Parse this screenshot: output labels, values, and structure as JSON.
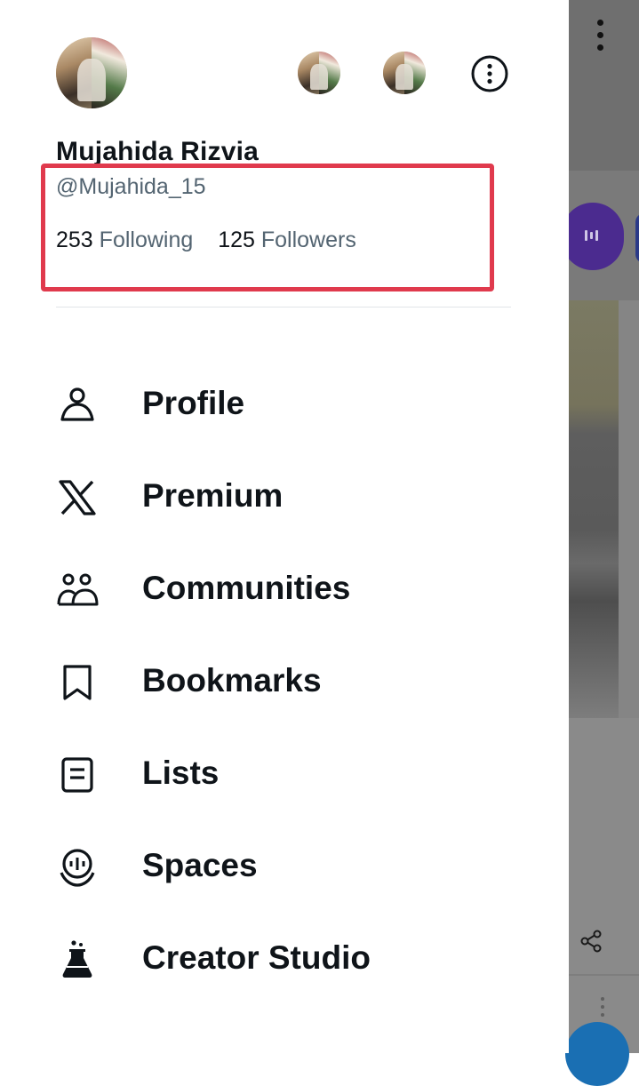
{
  "profile": {
    "name": "Mujahida Rizvia",
    "handle": "@Mujahida_15",
    "following_count": "253",
    "following_label": "Following",
    "followers_count": "125",
    "followers_label": "Followers"
  },
  "accounts": {
    "avatars": [
      "profile-avatar",
      "account-switch-1",
      "account-switch-2"
    ],
    "more_icon": "more-options-icon"
  },
  "menu": [
    {
      "label": "Profile",
      "icon": "person-icon"
    },
    {
      "label": "Premium",
      "icon": "x-logo-icon"
    },
    {
      "label": "Communities",
      "icon": "communities-icon"
    },
    {
      "label": "Bookmarks",
      "icon": "bookmark-icon"
    },
    {
      "label": "Lists",
      "icon": "list-icon"
    },
    {
      "label": "Spaces",
      "icon": "spaces-icon"
    },
    {
      "label": "Creator Studio",
      "icon": "creator-studio-flask-icon"
    }
  ],
  "colors": {
    "text_primary": "#0f1419",
    "text_secondary": "#536471",
    "highlight": "#e03a4d",
    "overlay": "#6f6f6f"
  }
}
